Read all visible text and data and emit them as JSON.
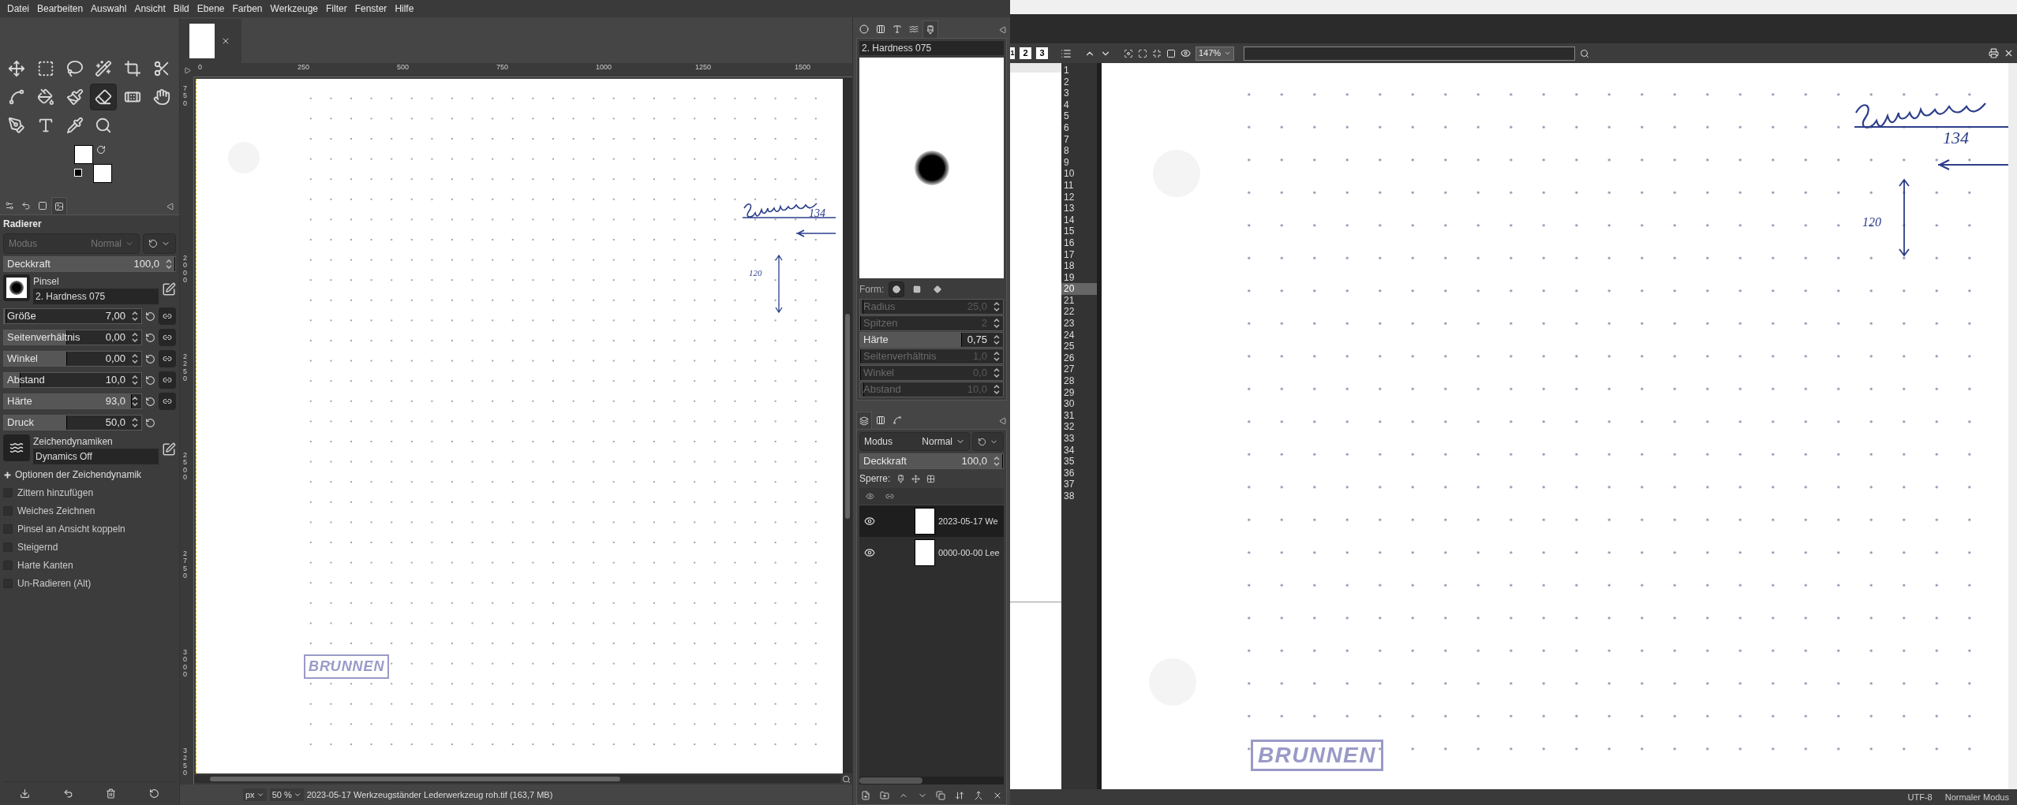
{
  "menu": [
    "Datei",
    "Bearbeiten",
    "Auswahl",
    "Ansicht",
    "Bild",
    "Ebene",
    "Farben",
    "Werkzeuge",
    "Filter",
    "Fenster",
    "Hilfe"
  ],
  "toolbox": {
    "tools": [
      {
        "selected": false
      },
      {
        "selected": false
      },
      {
        "selected": false
      },
      {
        "selected": false
      },
      {
        "selected": false
      },
      {
        "selected": false
      },
      {
        "selected": false
      },
      {
        "selected": false
      },
      {
        "selected": false
      },
      {
        "selected": true
      },
      {
        "selected": false
      },
      {
        "selected": false
      },
      {
        "selected": false
      },
      {
        "selected": false
      },
      {
        "selected": false
      },
      {
        "selected": false
      }
    ]
  },
  "tool_options": {
    "tabs": [
      {
        "selected": false
      },
      {
        "selected": false
      },
      {
        "selected": false
      },
      {
        "selected": true
      }
    ],
    "title": "Radierer",
    "mode": {
      "label": "Modus",
      "value": "Normal",
      "disabled": true
    },
    "opacity": {
      "label": "Deckkraft",
      "value": "100,0",
      "level": 1
    },
    "brush": {
      "label": "Pinsel",
      "value": "2. Hardness 075"
    },
    "sliders": [
      {
        "label": "Größe",
        "value": "7,00",
        "level": 0.02,
        "linkable": true
      },
      {
        "label": "Seitenverhältnis",
        "value": "0,00",
        "level": 0.46,
        "linkable": true
      },
      {
        "label": "Winkel",
        "value": "0,00",
        "level": 0.46,
        "linkable": true
      },
      {
        "label": "Abstand",
        "value": "10,0",
        "level": 0.12,
        "linkable": true
      },
      {
        "label": "Härte",
        "value": "93,0",
        "level": 0.93,
        "linkable": true
      },
      {
        "label": "Druck",
        "value": "50,0",
        "level": 0.46,
        "linkable": false
      }
    ],
    "dynamics": {
      "label": "Zeichendynamiken",
      "value": "Dynamics Off"
    },
    "expander": {
      "label": "Optionen der Zeichendynamik",
      "expanded": false
    },
    "options": [
      {
        "label": "Zittern hinzufügen",
        "checked": false
      },
      {
        "label": "Weiches Zeichnen",
        "checked": false
      },
      {
        "label": "Pinsel an Ansicht koppeln",
        "checked": false
      },
      {
        "label": "Steigernd",
        "checked": false
      },
      {
        "label": "Harte Kanten",
        "checked": false
      },
      {
        "label": "Un-Radieren (Alt)",
        "checked": false
      }
    ]
  },
  "image_tabs": [
    {
      "selected": true
    }
  ],
  "rulers": {
    "horizontal": [
      "0",
      "250",
      "500",
      "750",
      "1000",
      "1250",
      "1500"
    ],
    "vertical": [
      "750",
      "2000",
      "2250",
      "2500",
      "2750",
      "3000",
      "3250"
    ]
  },
  "canvas": {
    "numbers": [
      "134",
      "120"
    ],
    "logo": "BRUNNEN"
  },
  "status_bar": {
    "unit": "px",
    "zoom": "50 %",
    "file": "2023-05-17 Werkzeugständer Lederwerkzeug roh.tif (163,7 MB)"
  },
  "brush_dock": {
    "tabs": [
      {
        "selected": false
      },
      {
        "selected": false
      },
      {
        "selected": false
      },
      {
        "selected": false
      },
      {
        "selected": true
      }
    ],
    "name": "2. Hardness 075",
    "shape_label": "Form:",
    "shapes": [
      {
        "selected": true
      },
      {
        "selected": false
      },
      {
        "selected": false
      }
    ],
    "params": [
      {
        "label": "Radius",
        "value": "25,0",
        "level": 0.02,
        "disabled": true
      },
      {
        "label": "Spitzen",
        "value": "2",
        "level": 0,
        "disabled": true
      },
      {
        "label": "Härte",
        "value": "0,75",
        "level": 0.71,
        "disabled": false
      },
      {
        "label": "Seitenverhältnis",
        "value": "1,0",
        "level": 0,
        "disabled": true
      },
      {
        "label": "Winkel",
        "value": "0,0",
        "level": 0,
        "disabled": true
      },
      {
        "label": "Abstand",
        "value": "10,0",
        "level": 0.03,
        "disabled": true
      }
    ]
  },
  "layers_dock": {
    "tabs": [
      {
        "selected": true
      },
      {
        "selected": false
      },
      {
        "selected": false
      }
    ],
    "mode": {
      "label": "Modus",
      "value": "Normal"
    },
    "opacity": {
      "label": "Deckkraft",
      "value": "100,0",
      "level": 1
    },
    "lock_label": "Sperre:",
    "layers": [
      {
        "name": "2023-05-17 We",
        "visible": true,
        "selected": true
      },
      {
        "name": "0000-00-00 Lee",
        "visible": true,
        "selected": false
      }
    ]
  },
  "viewer": {
    "page_buttons": [
      "1",
      "2",
      "3"
    ],
    "zoom": "147%",
    "line_numbers": [
      {
        "label": "1",
        "selected": false
      },
      {
        "label": "2",
        "selected": false
      },
      {
        "label": "3",
        "selected": false
      },
      {
        "label": "4",
        "selected": false
      },
      {
        "label": "5",
        "selected": false
      },
      {
        "label": "6",
        "selected": false
      },
      {
        "label": "7",
        "selected": false
      },
      {
        "label": "8",
        "selected": false
      },
      {
        "label": "9",
        "selected": false
      },
      {
        "label": "10",
        "selected": false
      },
      {
        "label": "11",
        "selected": false
      },
      {
        "label": "12",
        "selected": false
      },
      {
        "label": "13",
        "selected": false
      },
      {
        "label": "14",
        "selected": false
      },
      {
        "label": "15",
        "selected": false
      },
      {
        "label": "16",
        "selected": false
      },
      {
        "label": "17",
        "selected": false
      },
      {
        "label": "18",
        "selected": false
      },
      {
        "label": "19",
        "selected": false
      },
      {
        "label": "20",
        "selected": true
      },
      {
        "label": "21",
        "selected": false
      },
      {
        "label": "22",
        "selected": false
      },
      {
        "label": "23",
        "selected": false
      },
      {
        "label": "24",
        "selected": false
      },
      {
        "label": "25",
        "selected": false
      },
      {
        "label": "26",
        "selected": false
      },
      {
        "label": "27",
        "selected": false
      },
      {
        "label": "28",
        "selected": false
      },
      {
        "label": "29",
        "selected": false
      },
      {
        "label": "30",
        "selected": false
      },
      {
        "label": "31",
        "selected": false
      },
      {
        "label": "32",
        "selected": false
      },
      {
        "label": "33",
        "selected": false
      },
      {
        "label": "34",
        "selected": false
      },
      {
        "label": "35",
        "selected": false
      },
      {
        "label": "36",
        "selected": false
      },
      {
        "label": "37",
        "selected": false
      },
      {
        "label": "38",
        "selected": false
      }
    ],
    "numbers": [
      "134",
      "120"
    ],
    "logo": "BRUNNEN",
    "status": [
      "UTF-8",
      "Normaler Modus"
    ]
  }
}
